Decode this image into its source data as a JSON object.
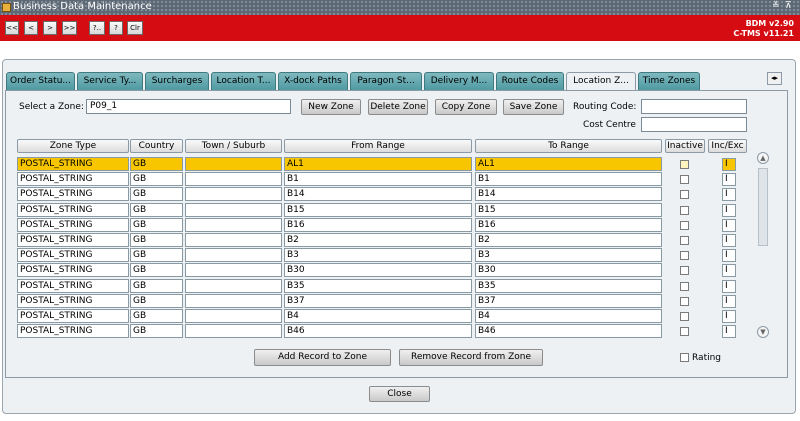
{
  "window": {
    "title": "Business Data Maintenance",
    "controls": [
      "≚",
      "⊼"
    ]
  },
  "toolbar": {
    "buttons": [
      "<<",
      "<",
      ">",
      ">>",
      "?..",
      "?",
      "Clr"
    ],
    "version_line1": "BDM v2.90",
    "version_line2": "C-TMS v11.21"
  },
  "tabs": [
    {
      "label": "Order Statu...",
      "active": false
    },
    {
      "label": "Service Ty...",
      "active": false
    },
    {
      "label": "Surcharges",
      "active": false
    },
    {
      "label": "Location T...",
      "active": false
    },
    {
      "label": "X-dock Paths",
      "active": false
    },
    {
      "label": "Paragon St...",
      "active": false
    },
    {
      "label": "Delivery M...",
      "active": false
    },
    {
      "label": "Route Codes",
      "active": false
    },
    {
      "label": "Location Z...",
      "active": true
    },
    {
      "label": "Time Zones",
      "active": false
    }
  ],
  "tab_scroll_label": "◂▸",
  "zone_form": {
    "select_zone_label": "Select a Zone:",
    "select_zone_value": "P09_1",
    "buttons": [
      "New Zone",
      "Delete Zone",
      "Copy Zone",
      "Save Zone"
    ],
    "routing_code_label": "Routing Code:",
    "routing_code_value": "",
    "cost_centre_label": "Cost Centre",
    "cost_centre_value": ""
  },
  "grid": {
    "columns": [
      "Zone Type",
      "Country",
      "Town / Suburb",
      "From Range",
      "To Range",
      "Inactive",
      "Inc/Exc"
    ],
    "rows": [
      {
        "zone_type": "POSTAL_STRING",
        "country": "GB",
        "town": "",
        "from": "AL1",
        "to": "AL1",
        "inactive": false,
        "inc_exc": "I",
        "selected": true
      },
      {
        "zone_type": "POSTAL_STRING",
        "country": "GB",
        "town": "",
        "from": "B1",
        "to": "B1",
        "inactive": false,
        "inc_exc": "I",
        "selected": false
      },
      {
        "zone_type": "POSTAL_STRING",
        "country": "GB",
        "town": "",
        "from": "B14",
        "to": "B14",
        "inactive": false,
        "inc_exc": "I",
        "selected": false
      },
      {
        "zone_type": "POSTAL_STRING",
        "country": "GB",
        "town": "",
        "from": "B15",
        "to": "B15",
        "inactive": false,
        "inc_exc": "I",
        "selected": false
      },
      {
        "zone_type": "POSTAL_STRING",
        "country": "GB",
        "town": "",
        "from": "B16",
        "to": "B16",
        "inactive": false,
        "inc_exc": "I",
        "selected": false
      },
      {
        "zone_type": "POSTAL_STRING",
        "country": "GB",
        "town": "",
        "from": "B2",
        "to": "B2",
        "inactive": false,
        "inc_exc": "I",
        "selected": false
      },
      {
        "zone_type": "POSTAL_STRING",
        "country": "GB",
        "town": "",
        "from": "B3",
        "to": "B3",
        "inactive": false,
        "inc_exc": "I",
        "selected": false
      },
      {
        "zone_type": "POSTAL_STRING",
        "country": "GB",
        "town": "",
        "from": "B30",
        "to": "B30",
        "inactive": false,
        "inc_exc": "I",
        "selected": false
      },
      {
        "zone_type": "POSTAL_STRING",
        "country": "GB",
        "town": "",
        "from": "B35",
        "to": "B35",
        "inactive": false,
        "inc_exc": "I",
        "selected": false
      },
      {
        "zone_type": "POSTAL_STRING",
        "country": "GB",
        "town": "",
        "from": "B37",
        "to": "B37",
        "inactive": false,
        "inc_exc": "I",
        "selected": false
      },
      {
        "zone_type": "POSTAL_STRING",
        "country": "GB",
        "town": "",
        "from": "B4",
        "to": "B4",
        "inactive": false,
        "inc_exc": "I",
        "selected": false
      },
      {
        "zone_type": "POSTAL_STRING",
        "country": "GB",
        "town": "",
        "from": "B46",
        "to": "B46",
        "inactive": false,
        "inc_exc": "I",
        "selected": false
      }
    ]
  },
  "scrollbar": {
    "up": "▲",
    "down": "▼"
  },
  "actions": {
    "add_record": "Add Record to Zone",
    "remove_record": "Remove Record from Zone",
    "rating_label": "Rating",
    "rating_checked": false,
    "close": "Close"
  },
  "colors": {
    "toolbar_red": "#d50d12",
    "selected_row": "#f7c600",
    "tab_teal": "#5fa6ad"
  }
}
